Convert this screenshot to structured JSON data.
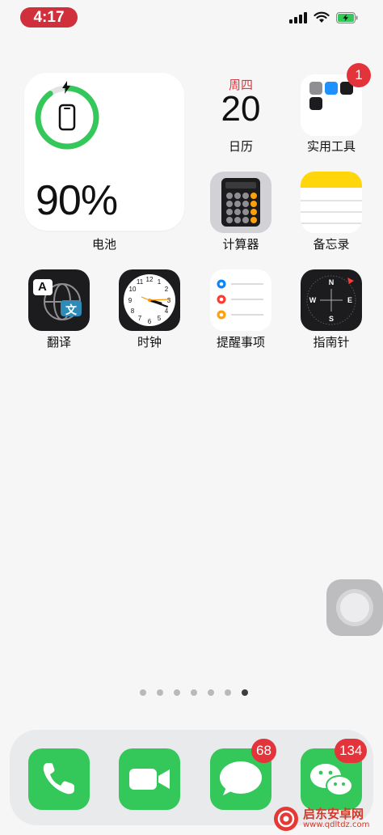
{
  "status_bar": {
    "time": "4:17"
  },
  "battery_widget": {
    "percent_text": "90%",
    "level": 0.9,
    "label": "电池",
    "ring_color": "#34c759"
  },
  "apps": {
    "calendar": {
      "weekday": "周四",
      "day": "20",
      "label": "日历"
    },
    "utilities_folder": {
      "label": "实用工具",
      "badge": "1"
    },
    "calculator": {
      "label": "计算器"
    },
    "notes": {
      "label": "备忘录"
    },
    "translate": {
      "label": "翻译",
      "glyph_a": "A",
      "glyph_wen": "文"
    },
    "clock": {
      "label": "时钟"
    },
    "reminders": {
      "label": "提醒事项"
    },
    "compass": {
      "label": "指南针"
    }
  },
  "page_dots": {
    "count": 7,
    "active_index": 6
  },
  "dock": {
    "phone": {},
    "facetime": {},
    "messages": {
      "badge": "68"
    },
    "wechat": {
      "badge": "134"
    }
  },
  "watermark": {
    "title": "启东安卓网",
    "url": "www.qdltdz.com"
  },
  "colors": {
    "badge_red": "#e3343b",
    "green": "#34c759",
    "calendar_red": "#e5333b"
  }
}
